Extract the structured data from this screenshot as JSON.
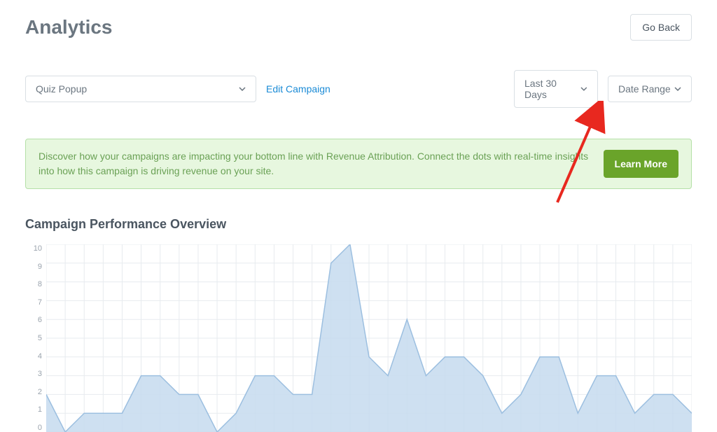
{
  "header": {
    "title": "Analytics",
    "go_back": "Go Back"
  },
  "controls": {
    "campaign_select_value": "Quiz Popup",
    "edit_link": "Edit Campaign",
    "period_select_value": "Last 30 Days",
    "range_select_value": "Date Range"
  },
  "banner": {
    "text": "Discover how your campaigns are impacting your bottom line with Revenue Attribution. Connect the dots with real-time insights into how this campaign is driving revenue on your site.",
    "cta": "Learn More"
  },
  "section": {
    "title": "Campaign Performance Overview"
  },
  "chart_data": {
    "type": "area",
    "title": "Campaign Performance Overview",
    "ylim": [
      0,
      10
    ],
    "yticks": [
      10,
      9,
      8,
      7,
      6,
      5,
      4,
      3,
      2,
      1,
      0
    ],
    "xlabel": "",
    "ylabel": "",
    "values": [
      2,
      0,
      1,
      1,
      1,
      3,
      3,
      2,
      2,
      0,
      1,
      3,
      3,
      2,
      2,
      9,
      10,
      4,
      3,
      6,
      3,
      4,
      4,
      3,
      1,
      2,
      4,
      4,
      1,
      3,
      3,
      1,
      2,
      2,
      1
    ]
  },
  "colors": {
    "area_fill": "#c5dbee",
    "area_stroke": "#9cbfe0",
    "grid": "#e7ebef"
  }
}
